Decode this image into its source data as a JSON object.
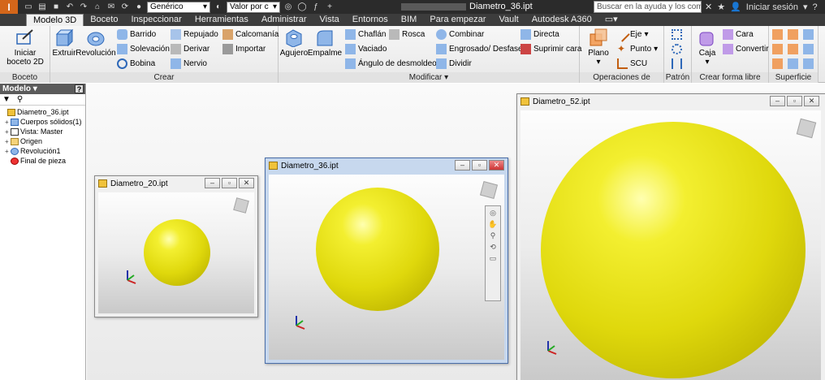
{
  "app": {
    "logo": "I",
    "doc_title": "Diametro_36.ipt",
    "search_placeholder": "Buscar en la ayuda y los comandos",
    "material_select": "Genérico",
    "appearance_select": "Valor por c",
    "signin": "Iniciar sesión"
  },
  "tabs": [
    "Modelo 3D",
    "Boceto",
    "Inspeccionar",
    "Herramientas",
    "Administrar",
    "Vista",
    "Entornos",
    "BIM",
    "Para empezar",
    "Vault",
    "Autodesk A360"
  ],
  "ribbon": {
    "boceto": {
      "label": "Boceto",
      "start": "Iniciar boceto 2D"
    },
    "crear": {
      "label": "Crear",
      "extruir": "Extruir",
      "revolucion": "Revolución",
      "barrido": "Barrido",
      "solevacion": "Solevación",
      "bobina": "Bobina",
      "repujado": "Repujado",
      "derivar": "Derivar",
      "nervio": "Nervio",
      "calcomania": "Calcomanía",
      "importar": "Importar"
    },
    "modificar": {
      "label": "Modificar",
      "agujero": "Agujero",
      "empalme": "Empalme",
      "chaflan": "Chaflán",
      "rosca": "Rosca",
      "vaciado": "Vaciado",
      "angulo": "Ángulo de desmoldeo",
      "combinar": "Combinar",
      "engrosado": "Engrosado/ Desfase",
      "dividir": "Dividir",
      "directa": "Directa",
      "suprimir": "Suprimir cara"
    },
    "operaciones": {
      "label": "Operaciones de trabajo",
      "plano": "Plano",
      "eje": "Eje",
      "punto": "Punto",
      "scu": "SCU"
    },
    "patron": {
      "label": "Patrón"
    },
    "forma_libre": {
      "label": "Crear forma libre",
      "caja": "Caja",
      "cara": "Cara",
      "convertir": "Convertir"
    },
    "superficie": {
      "label": "Superficie"
    }
  },
  "browser": {
    "title": "Modelo",
    "help": "?",
    "tree": [
      {
        "label": "Diametro_36.ipt",
        "expander": ""
      },
      {
        "label": "Cuerpos sólidos(1)",
        "expander": "+"
      },
      {
        "label": "Vista: Master",
        "expander": "+"
      },
      {
        "label": "Origen",
        "expander": "+"
      },
      {
        "label": "Revolución1",
        "expander": "+"
      },
      {
        "label": "Final de pieza",
        "expander": ""
      }
    ]
  },
  "windows": [
    {
      "title": "Diametro_20.ipt"
    },
    {
      "title": "Diametro_36.ipt"
    },
    {
      "title": "Diametro_52.ipt"
    }
  ],
  "colors": {
    "sphere": "#e6df10",
    "accent": "#d4661a"
  }
}
